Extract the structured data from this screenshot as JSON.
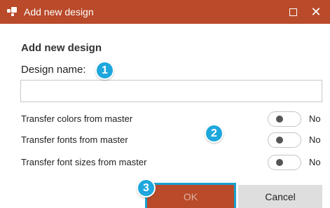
{
  "window": {
    "title": "Add new design",
    "maximize_icon": "maximize-icon",
    "close_glyph": "✕",
    "accent_color": "#b94a2a"
  },
  "form": {
    "heading": "Add new design",
    "design_name_label": "Design name:",
    "design_name_value": ""
  },
  "options": [
    {
      "label": "Transfer colors from master",
      "toggle_text": "No",
      "enabled": false
    },
    {
      "label": "Transfer fonts from master",
      "toggle_text": "No",
      "enabled": false
    },
    {
      "label": "Transfer font sizes from master",
      "toggle_text": "No",
      "enabled": false
    }
  ],
  "buttons": {
    "ok": "OK",
    "cancel": "Cancel"
  },
  "badges": [
    "1",
    "2",
    "3"
  ],
  "badge_color": "#1da7dc"
}
